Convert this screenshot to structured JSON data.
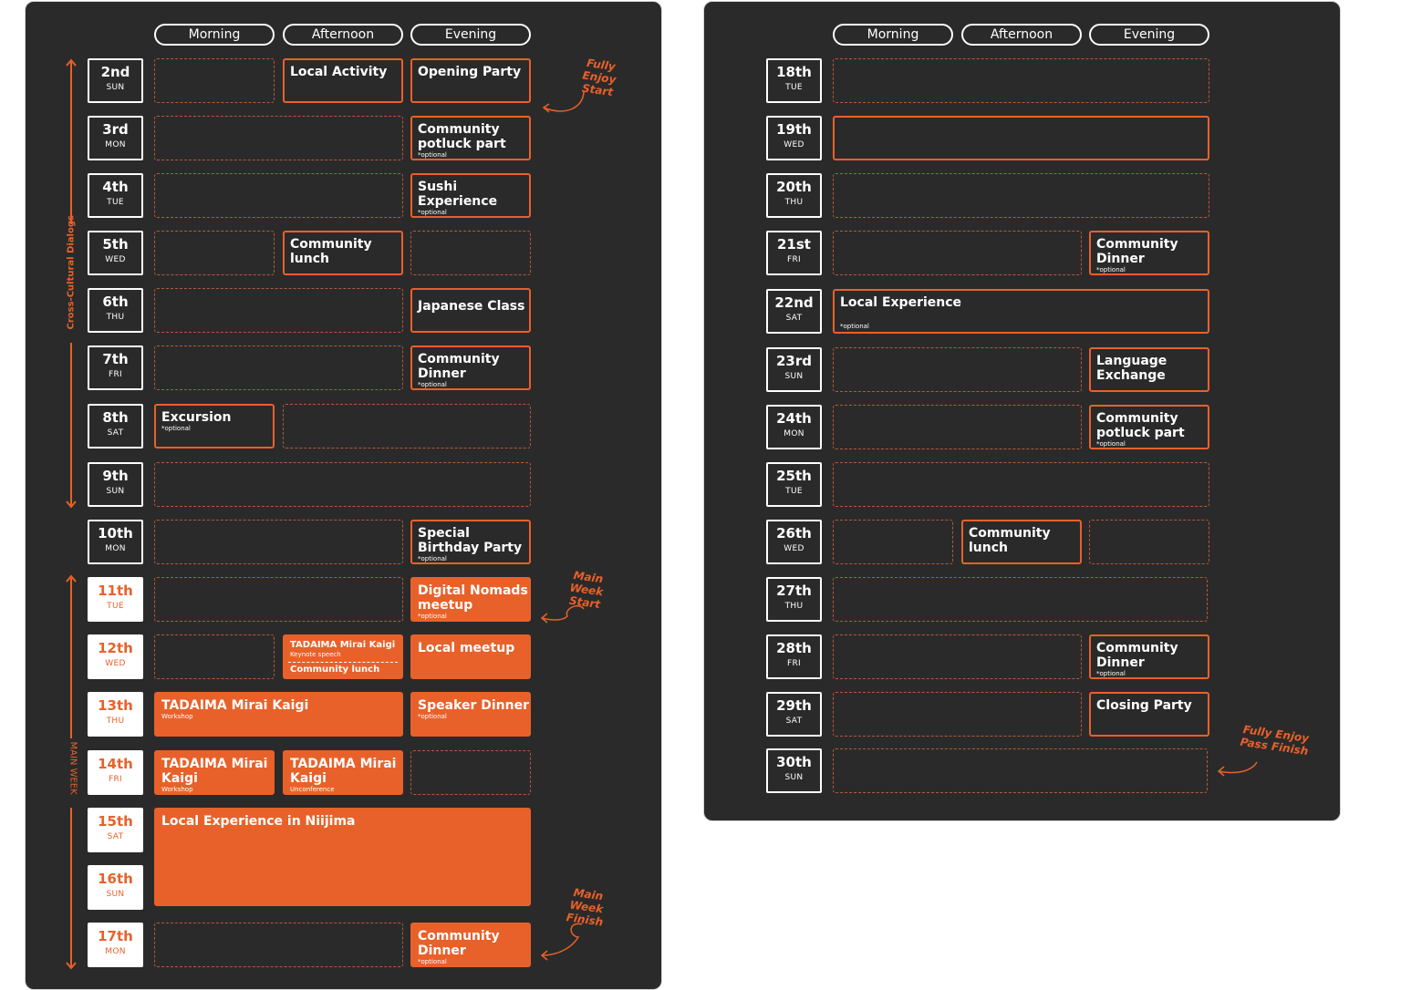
{
  "headers": {
    "morning": "Morning",
    "afternoon": "Afternoon",
    "evening": "Evening"
  },
  "side_labels": {
    "cross_cultural": "Cross-Cultural Dialogs",
    "main_week": "MAIN WEEK"
  },
  "notes": {
    "fully_enjoy_start": "Fully Enjoy Start",
    "main_week_start": "Main Week Start",
    "main_week_finish": "Main Week Finish",
    "fully_enjoy_pass_finish": "Fully Enjoy Pass Finish"
  },
  "left_dates": [
    {
      "num": "2nd",
      "wd": "SUN"
    },
    {
      "num": "3rd",
      "wd": "MON"
    },
    {
      "num": "4th",
      "wd": "TUE"
    },
    {
      "num": "5th",
      "wd": "WED"
    },
    {
      "num": "6th",
      "wd": "THU"
    },
    {
      "num": "7th",
      "wd": "FRI"
    },
    {
      "num": "8th",
      "wd": "SAT"
    },
    {
      "num": "9th",
      "wd": "SUN"
    },
    {
      "num": "10th",
      "wd": "MON"
    },
    {
      "num": "11th",
      "wd": "TUE"
    },
    {
      "num": "12th",
      "wd": "WED"
    },
    {
      "num": "13th",
      "wd": "THU"
    },
    {
      "num": "14th",
      "wd": "FRI"
    },
    {
      "num": "15th",
      "wd": "SAT"
    },
    {
      "num": "16th",
      "wd": "SUN"
    },
    {
      "num": "17th",
      "wd": "MON"
    }
  ],
  "right_dates": [
    {
      "num": "18th",
      "wd": "TUE"
    },
    {
      "num": "19th",
      "wd": "WED"
    },
    {
      "num": "20th",
      "wd": "THU"
    },
    {
      "num": "21st",
      "wd": "FRI"
    },
    {
      "num": "22nd",
      "wd": "SAT"
    },
    {
      "num": "23rd",
      "wd": "SUN"
    },
    {
      "num": "24th",
      "wd": "MON"
    },
    {
      "num": "25th",
      "wd": "TUE"
    },
    {
      "num": "26th",
      "wd": "WED"
    },
    {
      "num": "27th",
      "wd": "THU"
    },
    {
      "num": "28th",
      "wd": "FRI"
    },
    {
      "num": "29th",
      "wd": "SAT"
    },
    {
      "num": "30th",
      "wd": "SUN"
    }
  ],
  "events": {
    "local_activity": "Local Activity",
    "opening_party": "Opening Party",
    "community_potluck": "Community potluck part",
    "sushi_experience": "Sushi Experience",
    "community_lunch": "Community lunch",
    "japanese_class": "Japanese Class",
    "community_dinner": "Community Dinner",
    "excursion": "Excursion",
    "special_birthday": "Special Birthday Party",
    "digital_nomads": "Digital Nomads meetup",
    "tadaima_mirai_kaigi_small": "TADAIMA Mirai Kaigi",
    "keynote_speech": "Keynote speech",
    "local_meetup": "Local meetup",
    "tadaima_mirai_kaigi": "TADAIMA Mirai Kaigi",
    "workshop": "Workshop",
    "unconference": "Unconference",
    "speaker_dinner": "Speaker Dinner",
    "local_experience_niijima": "Local Experience in Niijima",
    "local_experience": "Local Experience",
    "language_exchange": "Language Exchange",
    "closing_party": "Closing Party",
    "optional": "*optional"
  }
}
